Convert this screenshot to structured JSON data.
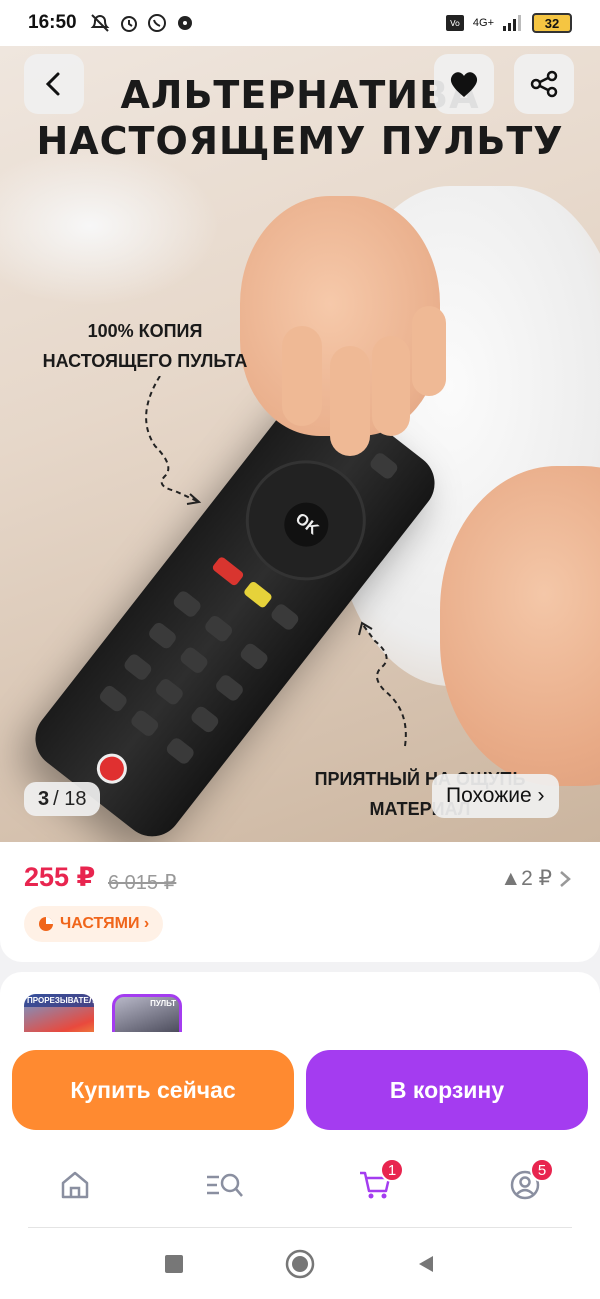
{
  "status_bar": {
    "time": "16:50",
    "battery": "32",
    "network": "4G+"
  },
  "hero": {
    "title_line1": "АЛЬТЕРНАТИВА",
    "title_line2": "НАСТОЯЩЕМУ ПУЛЬТУ",
    "note_top_line1": "100% КОПИЯ",
    "note_top_line2": "НАСТОЯЩЕГО ПУЛЬТА",
    "note_bottom_line1": "ПРИЯТНЫЙ НА ОЩУПЬ",
    "note_bottom_line2": "МАТЕРИАЛ",
    "remote_ok_label": "OK",
    "counter_current": "3",
    "counter_total": "/ 18",
    "similar_label": "Похожие ›"
  },
  "price": {
    "current": "255 ₽",
    "old": "6 015 ₽",
    "bonus": "▲2 ₽",
    "installments": "ЧАСТЯМИ ›"
  },
  "variants": {
    "thumb1_label": "ПРОРЕЗЫВАТЕЛЬ",
    "thumb2_label": "ПУЛЬТ"
  },
  "actions": {
    "buy_now": "Купить сейчас",
    "add_to_cart": "В корзину"
  },
  "tabbar": {
    "cart_badge": "1",
    "profile_badge": "5"
  },
  "colors": {
    "price": "#e8254f",
    "buy": "#ff8a30",
    "cart": "#a43cf0",
    "installments_text": "#f0651a"
  }
}
